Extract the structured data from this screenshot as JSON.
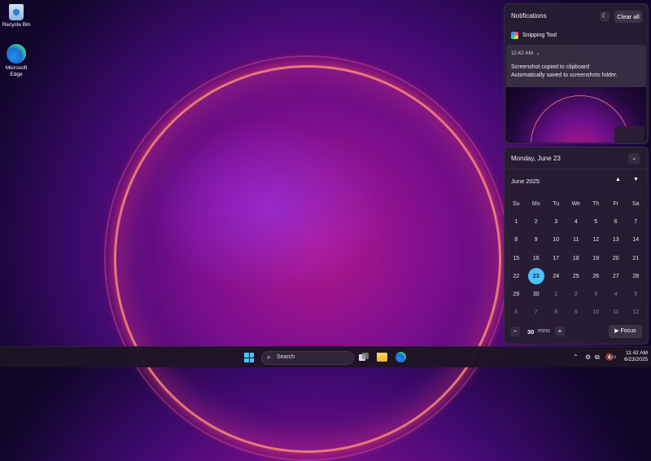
{
  "desktop": {
    "icons": [
      {
        "label": "Recycle Bin",
        "icon": "recycle-bin-icon"
      },
      {
        "label": "Microsoft Edge",
        "icon": "edge-icon"
      }
    ]
  },
  "notifications": {
    "title": "Notifications",
    "clear_all": "Clear all",
    "app_name": "Snipping Tool",
    "card": {
      "time": "11:42 AM",
      "line1": "Screenshot copied to clipboard",
      "line2": "Automatically saved to screenshots folder."
    }
  },
  "calendar": {
    "date_header": "Monday, June 23",
    "month": "June 2025",
    "weekdays": [
      "Su",
      "Mo",
      "Tu",
      "We",
      "Th",
      "Fr",
      "Sa"
    ],
    "days": [
      {
        "d": "1",
        "dim": false
      },
      {
        "d": "2",
        "dim": false
      },
      {
        "d": "3",
        "dim": false
      },
      {
        "d": "4",
        "dim": false
      },
      {
        "d": "5",
        "dim": false
      },
      {
        "d": "6",
        "dim": false
      },
      {
        "d": "7",
        "dim": false
      },
      {
        "d": "8",
        "dim": false
      },
      {
        "d": "9",
        "dim": false
      },
      {
        "d": "10",
        "dim": false
      },
      {
        "d": "11",
        "dim": false
      },
      {
        "d": "12",
        "dim": false
      },
      {
        "d": "13",
        "dim": false
      },
      {
        "d": "14",
        "dim": false
      },
      {
        "d": "15",
        "dim": false
      },
      {
        "d": "16",
        "dim": false
      },
      {
        "d": "17",
        "dim": false
      },
      {
        "d": "18",
        "dim": false
      },
      {
        "d": "19",
        "dim": false
      },
      {
        "d": "20",
        "dim": false
      },
      {
        "d": "21",
        "dim": false
      },
      {
        "d": "22",
        "dim": false
      },
      {
        "d": "23",
        "dim": false,
        "today": true
      },
      {
        "d": "24",
        "dim": false
      },
      {
        "d": "25",
        "dim": false
      },
      {
        "d": "26",
        "dim": false
      },
      {
        "d": "27",
        "dim": false
      },
      {
        "d": "28",
        "dim": false
      },
      {
        "d": "29",
        "dim": false
      },
      {
        "d": "30",
        "dim": false
      },
      {
        "d": "1",
        "dim": true
      },
      {
        "d": "2",
        "dim": true
      },
      {
        "d": "3",
        "dim": true
      },
      {
        "d": "4",
        "dim": true
      },
      {
        "d": "5",
        "dim": true
      },
      {
        "d": "6",
        "dim": true
      },
      {
        "d": "7",
        "dim": true
      },
      {
        "d": "8",
        "dim": true
      },
      {
        "d": "9",
        "dim": true
      },
      {
        "d": "10",
        "dim": true
      },
      {
        "d": "11",
        "dim": true
      },
      {
        "d": "12",
        "dim": true
      }
    ],
    "focus": {
      "value": "30",
      "unit": "mins",
      "button": "Focus"
    },
    "accent": "#4cc2ff"
  },
  "taskbar": {
    "search_placeholder": "Search",
    "time": "11:42 AM",
    "date": "6/23/2025"
  }
}
